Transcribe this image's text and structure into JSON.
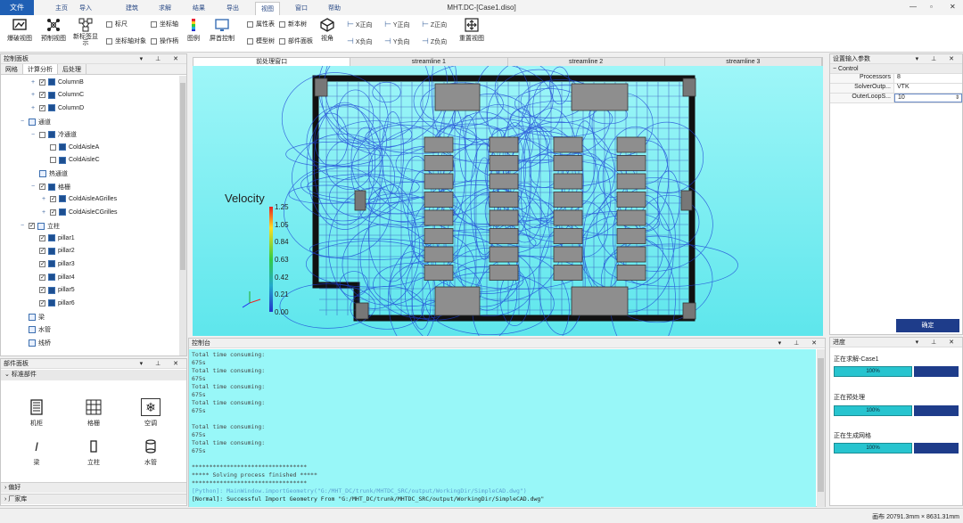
{
  "app": {
    "title": "MHT.DC-[Case1.diso]",
    "file_label": "文件",
    "menu_tabs": [
      "主页",
      "导入",
      "建筑",
      "求解",
      "结果",
      "导出",
      "视图",
      "窗口",
      "帮助"
    ],
    "active_menu": "视图"
  },
  "ribbon": {
    "big_buttons": [
      "爆破视图",
      "预制视图",
      "新标签显示",
      "图例",
      "屏首控制",
      "视角",
      "重置视图"
    ],
    "checkboxes": [
      {
        "label": "标尺",
        "checked": false
      },
      {
        "label": "坐标轴",
        "checked": false
      },
      {
        "label": "坐标轴对象",
        "checked": false
      },
      {
        "label": "操作柄",
        "checked": false
      },
      {
        "label": "属性表",
        "checked": false
      },
      {
        "label": "新本树",
        "checked": false
      },
      {
        "label": "模型树",
        "checked": false
      },
      {
        "label": "部件面板",
        "checked": false
      }
    ],
    "axes": [
      "X正向",
      "Y正向",
      "Z正向",
      "X负向",
      "Y负向",
      "Z负向"
    ]
  },
  "control_panel": {
    "title": "控制面板",
    "tabs": [
      "网格",
      "计算分析",
      "后处理"
    ],
    "active_tab": "计算分析",
    "tree": [
      {
        "label": "ColumnB",
        "indent": 2,
        "checked": true,
        "expander": "+"
      },
      {
        "label": "ColumnC",
        "indent": 2,
        "checked": true,
        "expander": "+"
      },
      {
        "label": "ColumnD",
        "indent": 2,
        "checked": true,
        "expander": "+"
      },
      {
        "label": "通道",
        "indent": 1,
        "checked": null,
        "expander": "−"
      },
      {
        "label": "冷通道",
        "indent": 2,
        "checked": false,
        "expander": "−"
      },
      {
        "label": "ColdAisleA",
        "indent": 3,
        "checked": false,
        "expander": ""
      },
      {
        "label": "ColdAisleC",
        "indent": 3,
        "checked": false,
        "expander": ""
      },
      {
        "label": "热通道",
        "indent": 2,
        "checked": null,
        "expander": ""
      },
      {
        "label": "格栅",
        "indent": 2,
        "checked": true,
        "expander": "−"
      },
      {
        "label": "ColdAisleAGrilles",
        "indent": 3,
        "checked": true,
        "expander": "+"
      },
      {
        "label": "ColdAisleCGrilles",
        "indent": 3,
        "checked": true,
        "expander": "+"
      },
      {
        "label": "立柱",
        "indent": 1,
        "checked": true,
        "expander": "−"
      },
      {
        "label": "pillar1",
        "indent": 2,
        "checked": true,
        "expander": ""
      },
      {
        "label": "pillar2",
        "indent": 2,
        "checked": true,
        "expander": ""
      },
      {
        "label": "pillar3",
        "indent": 2,
        "checked": true,
        "expander": ""
      },
      {
        "label": "pillar4",
        "indent": 2,
        "checked": true,
        "expander": ""
      },
      {
        "label": "pillar5",
        "indent": 2,
        "checked": true,
        "expander": ""
      },
      {
        "label": "pillar6",
        "indent": 2,
        "checked": true,
        "expander": ""
      },
      {
        "label": "梁",
        "indent": 1,
        "checked": null,
        "expander": ""
      },
      {
        "label": "水管",
        "indent": 1,
        "checked": null,
        "expander": ""
      },
      {
        "label": "线桥",
        "indent": 1,
        "checked": null,
        "expander": ""
      }
    ]
  },
  "parts_panel": {
    "title": "部件面板",
    "section": "标准部件",
    "items": [
      "机柜",
      "格栅",
      "空调",
      "梁",
      "立柱",
      "水管"
    ],
    "footer_sections": [
      "偏好",
      "厂家库"
    ]
  },
  "viewport": {
    "tabs": [
      "前处理窗口",
      "streamline 1",
      "streamline 2",
      "streamline 3"
    ],
    "active_tab": "前处理窗口",
    "legend_title": "Velocity",
    "legend_ticks": [
      "1.25",
      "1.05",
      "0.84",
      "0.63",
      "0.42",
      "0.21",
      "0.00"
    ]
  },
  "console": {
    "title": "控制台",
    "lines": [
      "Total time consuming:",
      "675s",
      "Total time consuming:",
      "675s",
      "Total time consuming:",
      "675s",
      "Total time consuming:",
      "675s",
      "",
      "Total time consuming:",
      "675s",
      "Total time consuming:",
      "675s",
      "",
      "*********************************",
      "***** Solving process finished *****",
      "*********************************",
      "[Python]: MainWindow.importGeometry(\"G:/MHT_DC/trunk/MHTDC_SRC/output/WorkingDir/SimpleCAD.dwg\")",
      "[Normal]: Successful Import Geometry From \"G:/MHT_DC/trunk/MHTDC_SRC/output/WorkingDir/SimpleCAD.dwg\""
    ]
  },
  "settings": {
    "title": "设置输入参数",
    "group": "Control",
    "rows": [
      {
        "key": "Processors",
        "value": "8"
      },
      {
        "key": "SolverOutp...",
        "value": "VTK"
      },
      {
        "key": "OuterLoopS...",
        "value": "10"
      }
    ],
    "confirm": "确定"
  },
  "progress": {
    "title": "进度",
    "items": [
      {
        "label": "正在求解-Case1",
        "value": "100%"
      },
      {
        "label": "正在预处理",
        "value": "100%"
      },
      {
        "label": "正在生成网格",
        "value": "100%"
      }
    ]
  },
  "status": {
    "text": "画布 20791.3mm × 8631.31mm"
  },
  "colors": {
    "accent": "#1f5fb4",
    "viewport_bg": "#7ff1f4",
    "console_bg": "#98f7f8",
    "progress_fill": "#27c4cf",
    "button_dark": "#1e3c8a"
  }
}
